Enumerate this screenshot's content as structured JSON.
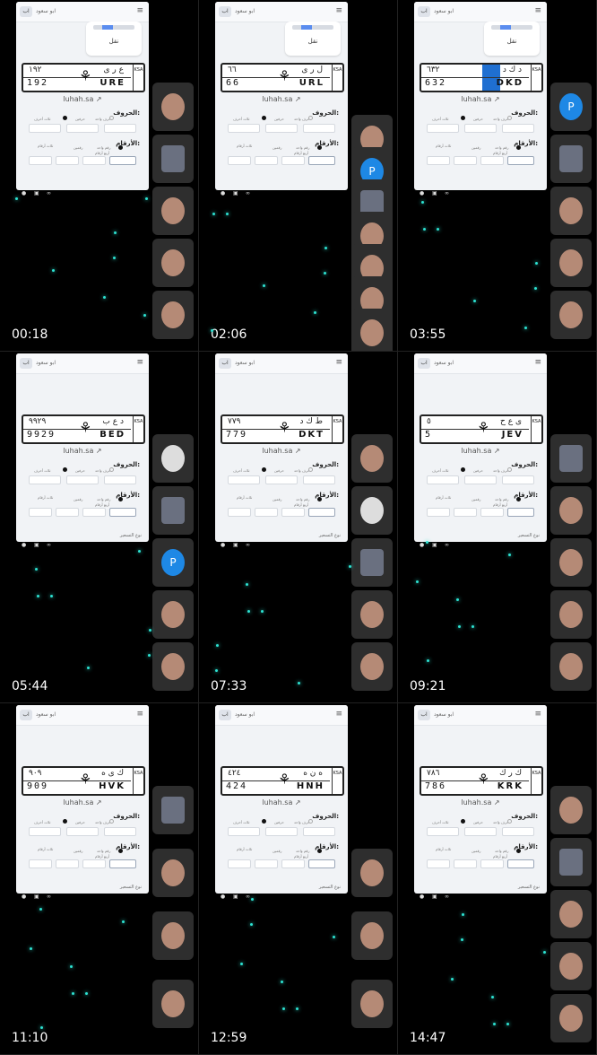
{
  "user_name": "ابو سعود",
  "avatar_initial": "اب",
  "site": "luhah.sa",
  "card_label": "نقل",
  "letters_heading": "الحروف:",
  "digits_heading": "الأرقام:",
  "letter_options": [
    "حرف واحد",
    "حرفين",
    "ثلاث أحرف"
  ],
  "digit_options": [
    "رقم واحد",
    "رقمين",
    "ثلاث أرقام",
    "أربع أرقام"
  ],
  "sort_label": "نوع التسعير",
  "ksa_text": "KSA",
  "icon_names": [
    "location-icon",
    "card-icon",
    "link-icon",
    "menu-icon",
    "external-link-icon",
    "verified-icon"
  ],
  "colors": {
    "accent": "#1f6fd1",
    "spark": "#2de2d2",
    "background": "#000000"
  },
  "tiles": [
    {
      "time": "00:18",
      "ar_num": "١٩٢",
      "en_num": "192",
      "ar_let": "ع ر ى",
      "en_let": "URE"
    },
    {
      "time": "02:06",
      "ar_num": "٦٦",
      "en_num": "66",
      "ar_let": "ل ر ى",
      "en_let": "URL"
    },
    {
      "time": "03:55",
      "ar_num": "٦٣٢",
      "en_num": "632",
      "ar_let": "د ك د",
      "en_let": "DKD"
    },
    {
      "time": "05:44",
      "ar_num": "٩٩٢٩",
      "en_num": "9929",
      "ar_let": "د ع ب",
      "en_let": "BED"
    },
    {
      "time": "07:33",
      "ar_num": "٧٧٩",
      "en_num": "779",
      "ar_let": "ط ك د",
      "en_let": "DKT"
    },
    {
      "time": "09:21",
      "ar_num": "٥",
      "en_num": "5",
      "ar_let": "ى ع ح",
      "en_let": "JEV"
    },
    {
      "time": "11:10",
      "ar_num": "٩٠٩",
      "en_num": "909",
      "ar_let": "ك ى ه",
      "en_let": "HVK"
    },
    {
      "time": "12:59",
      "ar_num": "٤٢٤",
      "en_num": "424",
      "ar_let": "ه ن ه",
      "en_let": "HNH"
    },
    {
      "time": "14:47",
      "ar_num": "٧٨٦",
      "en_num": "786",
      "ar_let": "ك ر ك",
      "en_let": "KRK"
    }
  ]
}
